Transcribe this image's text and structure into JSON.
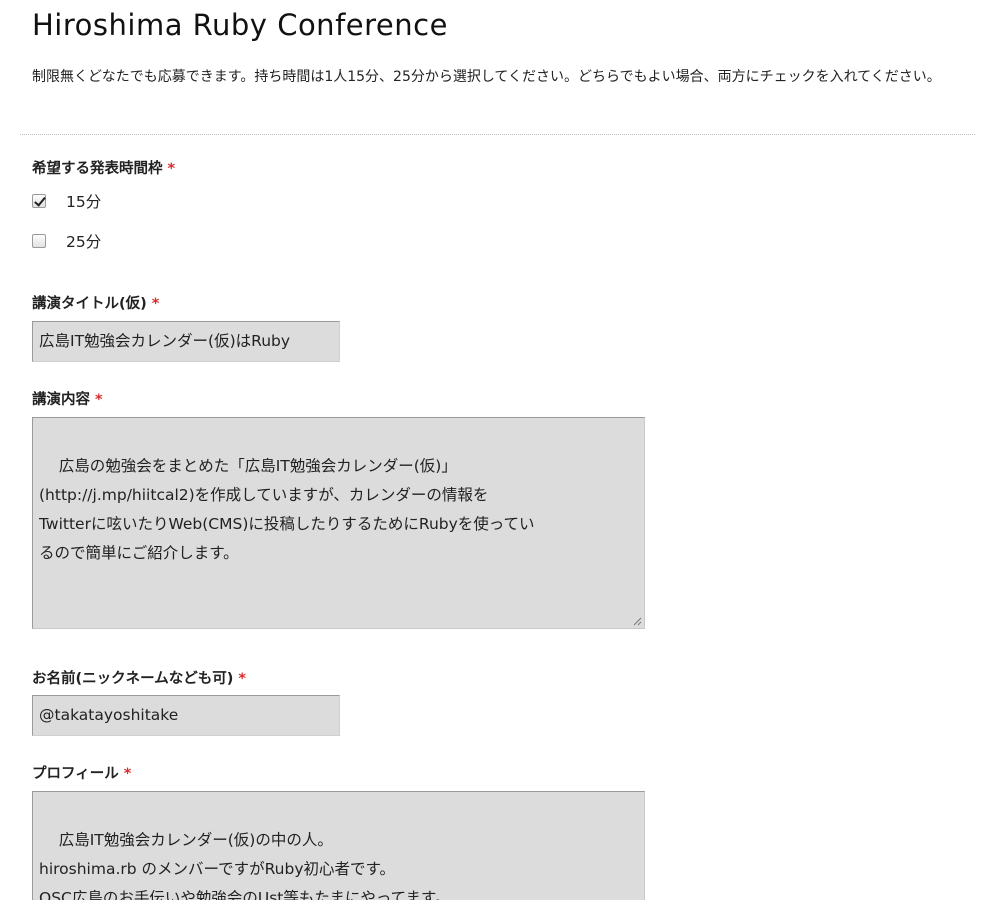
{
  "form": {
    "title": "Hiroshima Ruby Conference",
    "description": "制限無くどなたでも応募できます。持ち時間は1人15分、25分から選択してください。どちらでもよい場合、両方にチェックを入れてください。",
    "required_mark": "*"
  },
  "questions": {
    "time_slot": {
      "label": "希望する発表時間枠",
      "options": [
        {
          "label": "15分",
          "checked": true
        },
        {
          "label": "25分",
          "checked": false
        }
      ]
    },
    "talk_title": {
      "label": "講演タイトル(仮)",
      "value": "広島IT勉強会カレンダー(仮)はRuby"
    },
    "talk_content": {
      "label": "講演内容",
      "value": "広島の勉強会をまとめた「広島IT勉強会カレンダー(仮)」\n(http://j.mp/hiitcal2)を作成していますが、カレンダーの情報を\nTwitterに呟いたりWeb(CMS)に投稿したりするためにRubyを使ってい\nるので簡単にご紹介します。"
    },
    "name": {
      "label": "お名前(ニックネームなども可)",
      "value": "@takatayoshitake"
    },
    "profile": {
      "label": "プロフィール",
      "value": "広島IT勉強会カレンダー(仮)の中の人。\nhiroshima.rb のメンバーですがRuby初心者です。\nOSC広島のお手伝いや勉強会のUst等もたまにやってます。"
    }
  }
}
